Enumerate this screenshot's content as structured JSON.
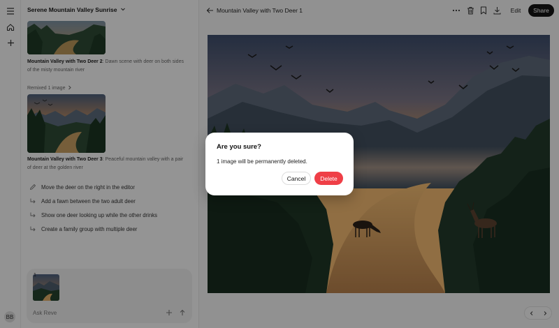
{
  "chat": {
    "title": "Serene Mountain Valley Sunrise",
    "items": [
      {
        "name": "Mountain Valley with Two Deer 2",
        "desc": ": Dawn scene with deer on both sides of the misty mountain river"
      },
      {
        "name": "Mountain Valley with Two Deer 3",
        "desc": ": Peaceful mountain valley with a pair of deer at the golden river"
      }
    ],
    "remix_label": "Remixed 1 image",
    "suggestions": [
      {
        "label": "Move the deer on the right in the editor",
        "icon": "pencil-icon"
      },
      {
        "label": "Add a fawn between the two adult deer",
        "icon": "reply-arrow-icon"
      },
      {
        "label": "Show one deer looking up while the other drinks",
        "icon": "reply-arrow-icon"
      },
      {
        "label": "Create a family group with multiple deer",
        "icon": "reply-arrow-icon"
      }
    ],
    "composer": {
      "attachment_count": "1",
      "placeholder": "Ask Reve"
    }
  },
  "rail": {
    "avatar_initials": "BB"
  },
  "main": {
    "title": "Mountain Valley with Two Deer 1",
    "edit_label": "Edit",
    "share_label": "Share"
  },
  "dialog": {
    "title": "Are you sure?",
    "message": "1 image will be permanently deleted.",
    "cancel_label": "Cancel",
    "delete_label": "Delete"
  },
  "colors": {
    "delete": "#ef3f47",
    "share_bg": "#141414",
    "overlay": "rgba(0,0,0,0.40)"
  }
}
